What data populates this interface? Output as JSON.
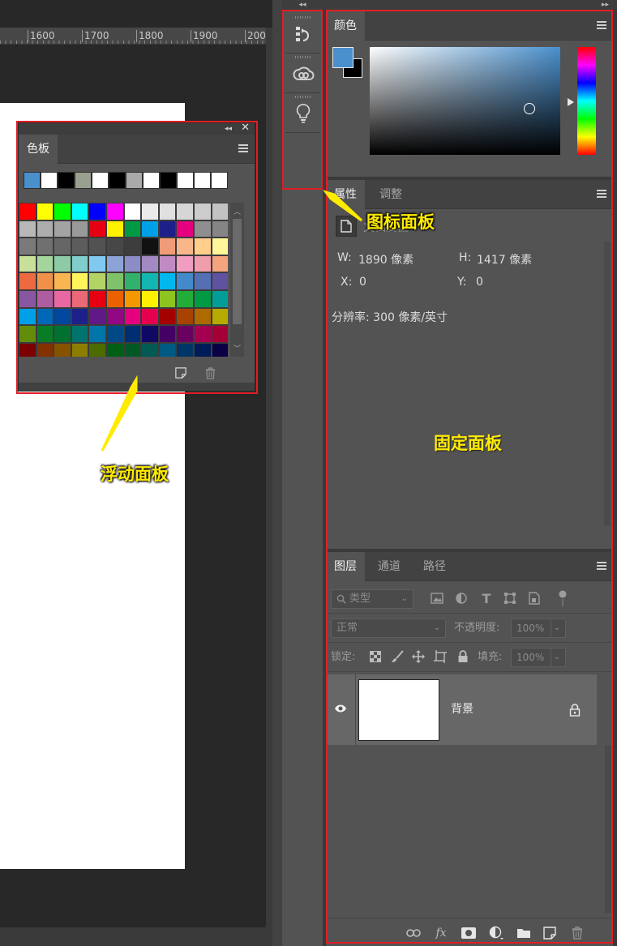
{
  "ruler": {
    "labels": [
      "1600",
      "1700",
      "1800",
      "1900",
      "200"
    ]
  },
  "float_panel": {
    "tab": "色板",
    "recent_swatches": [
      "#4a90cd",
      "#ffffff",
      "#000000",
      "#9aa091",
      "#ffffff",
      "#000000",
      "#aaaaaa",
      "#ffffff",
      "#000000",
      "#ffffff",
      "#ffffff",
      "#ffffff"
    ],
    "swatches": [
      "#ff0000",
      "#ffff00",
      "#00ff00",
      "#00ffff",
      "#0000ff",
      "#ff00ff",
      "#ffffff",
      "#ebebeb",
      "#e0e0e0",
      "#d6d6d6",
      "#cccccc",
      "#c2c2c2",
      "#b8b8b8",
      "#adadad",
      "#a3a3a3",
      "#999999",
      "#e60012",
      "#fff100",
      "#009944",
      "#00a0e9",
      "#1d2088",
      "#e4007f",
      "#8f8f8f",
      "#858585",
      "#7a7a7a",
      "#707070",
      "#666666",
      "#5c5c5c",
      "#525252",
      "#474747",
      "#3d3d3d",
      "#111111",
      "#f19b78",
      "#f9b68b",
      "#ffce8b",
      "#fff799",
      "#c8e09a",
      "#a5d59d",
      "#8ccba6",
      "#7fcdcd",
      "#80c9f0",
      "#8ba3d6",
      "#8c8dc8",
      "#a389c4",
      "#c08bc3",
      "#f19dc2",
      "#f09eab",
      "#f4a57e",
      "#ec6941",
      "#f19149",
      "#f8b551",
      "#fff45c",
      "#b3d465",
      "#80c269",
      "#32b16c",
      "#13b5b1",
      "#00b7ee",
      "#448aca",
      "#556fb5",
      "#5f52a0",
      "#8957a1",
      "#ae5da1",
      "#ea68a2",
      "#eb6877",
      "#e60012",
      "#eb6100",
      "#f39800",
      "#fff100",
      "#8fc31f",
      "#22ac38",
      "#009944",
      "#009e96",
      "#00a0e9",
      "#0068b7",
      "#00479d",
      "#1d2088",
      "#601986",
      "#920783",
      "#e4007f",
      "#e5004f",
      "#a40000",
      "#a84200",
      "#ac6a00",
      "#b7aa00",
      "#638c0b",
      "#097c25",
      "#007130",
      "#00736d",
      "#0075a9",
      "#004986",
      "#002e73",
      "#100964",
      "#440062",
      "#6a005f",
      "#a4004f",
      "#a40035",
      "#7d0000",
      "#833100",
      "#855300",
      "#8c7e00",
      "#4c6c00",
      "#005e15",
      "#005825",
      "#005a53",
      "#005982",
      "#003567",
      "#001c58",
      "#0a0046"
    ]
  },
  "color_panel": {
    "tab": "颜色",
    "foreground": "#4a90cd",
    "background": "#000000"
  },
  "properties_panel": {
    "tabs": [
      "属性",
      "调整"
    ],
    "doc_label": "文档属性",
    "w_label": "W:",
    "w_value": "1890 像素",
    "h_label": "H:",
    "h_value": "1417 像素",
    "x_label": "X:",
    "x_value": "0",
    "y_label": "Y:",
    "y_value": "0",
    "resolution": "分辨率: 300 像素/英寸"
  },
  "layers_panel": {
    "tabs": [
      "图层",
      "通道",
      "路径"
    ],
    "filter_placeholder": "类型",
    "blend_mode": "正常",
    "opacity_label": "不透明度:",
    "opacity_value": "100%",
    "lock_label": "锁定:",
    "fill_label": "填充:",
    "fill_value": "100%",
    "layer_name": "背景"
  },
  "annotations": {
    "icon_panel": "图标面板",
    "fixed_panel": "固定面板",
    "floating_panel": "浮动面板"
  },
  "colors": {
    "annotation_red": "#e21d25",
    "annotation_yellow": "#ffeb00"
  }
}
